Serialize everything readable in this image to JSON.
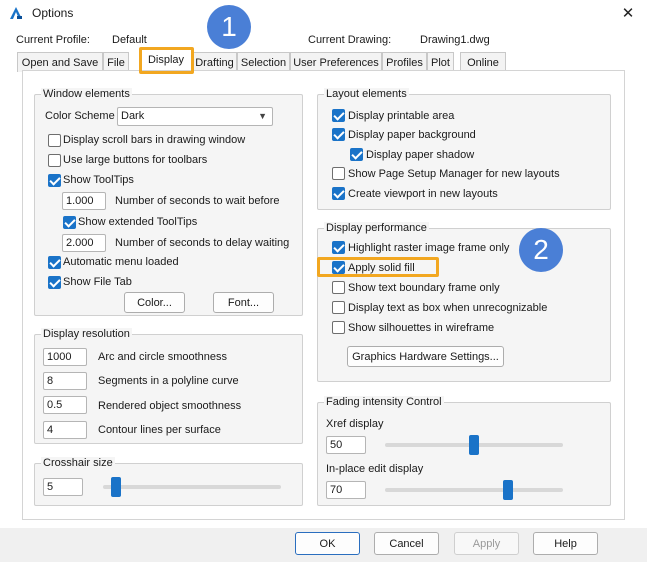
{
  "window": {
    "title": "Options",
    "close_glyph": "✕"
  },
  "profile": {
    "label": "Current Profile:",
    "value": "Default",
    "drawing_label": "Current Drawing:",
    "drawing_value": "Drawing1.dwg"
  },
  "tabs": [
    "Open and Save",
    "File",
    "Display",
    "Drafting",
    "Selection",
    "User Preferences",
    "Profiles",
    "Plot",
    "Online"
  ],
  "active_tab": "Display",
  "window_elements": {
    "title": "Window elements",
    "color_scheme_label": "Color Scheme",
    "color_scheme_value": "Dark",
    "scroll_bars": "Display scroll bars in drawing window",
    "large_buttons": "Use large buttons for toolbars",
    "show_tooltips": "Show ToolTips",
    "seconds_wait_value": "1.000",
    "seconds_wait_label": "Number of seconds to wait before",
    "extended_tooltips": "Show extended ToolTips",
    "seconds_delay_value": "2.000",
    "seconds_delay_label": "Number of seconds to delay waiting",
    "auto_menu": "Automatic menu loaded",
    "file_tab": "Show File Tab",
    "color_button": "Color...",
    "font_button": "Font..."
  },
  "display_resolution": {
    "title": "Display resolution",
    "rows": [
      {
        "value": "1000",
        "label": "Arc and circle smoothness"
      },
      {
        "value": "8",
        "label": "Segments in a polyline curve"
      },
      {
        "value": "0.5",
        "label": "Rendered object smoothness"
      },
      {
        "value": "4",
        "label": "Contour lines per surface"
      }
    ]
  },
  "crosshair": {
    "title": "Crosshair size",
    "value": "5",
    "level": 0.05
  },
  "layout_elements": {
    "title": "Layout elements",
    "printable_area": "Display printable area",
    "paper_background": "Display paper background",
    "paper_shadow": "Display paper shadow",
    "page_setup": "Show Page Setup Manager for new layouts",
    "create_viewport": "Create viewport in new layouts"
  },
  "display_performance": {
    "title": "Display performance",
    "highlight_raster": "Highlight raster image frame only",
    "apply_solid_fill": "Apply solid fill",
    "text_boundary": "Show text boundary frame only",
    "text_as_box": "Display text as box when unrecognizable",
    "silhouettes": "Show silhouettes in wireframe",
    "graphics_button": "Graphics Hardware Settings..."
  },
  "fading": {
    "title": "Fading intensity Control",
    "xref_label": "Xref display",
    "xref_value": "50",
    "xref_level": 0.5,
    "inplace_label": "In-place edit display",
    "inplace_value": "70",
    "inplace_level": 0.7
  },
  "callouts": {
    "one": "1",
    "two": "2"
  },
  "footer": {
    "ok": "OK",
    "cancel": "Cancel",
    "apply": "Apply",
    "help": "Help"
  },
  "colors": {
    "accent": "#1a73c8",
    "callout": "#4a7fd6",
    "highlight": "#f2a720"
  }
}
